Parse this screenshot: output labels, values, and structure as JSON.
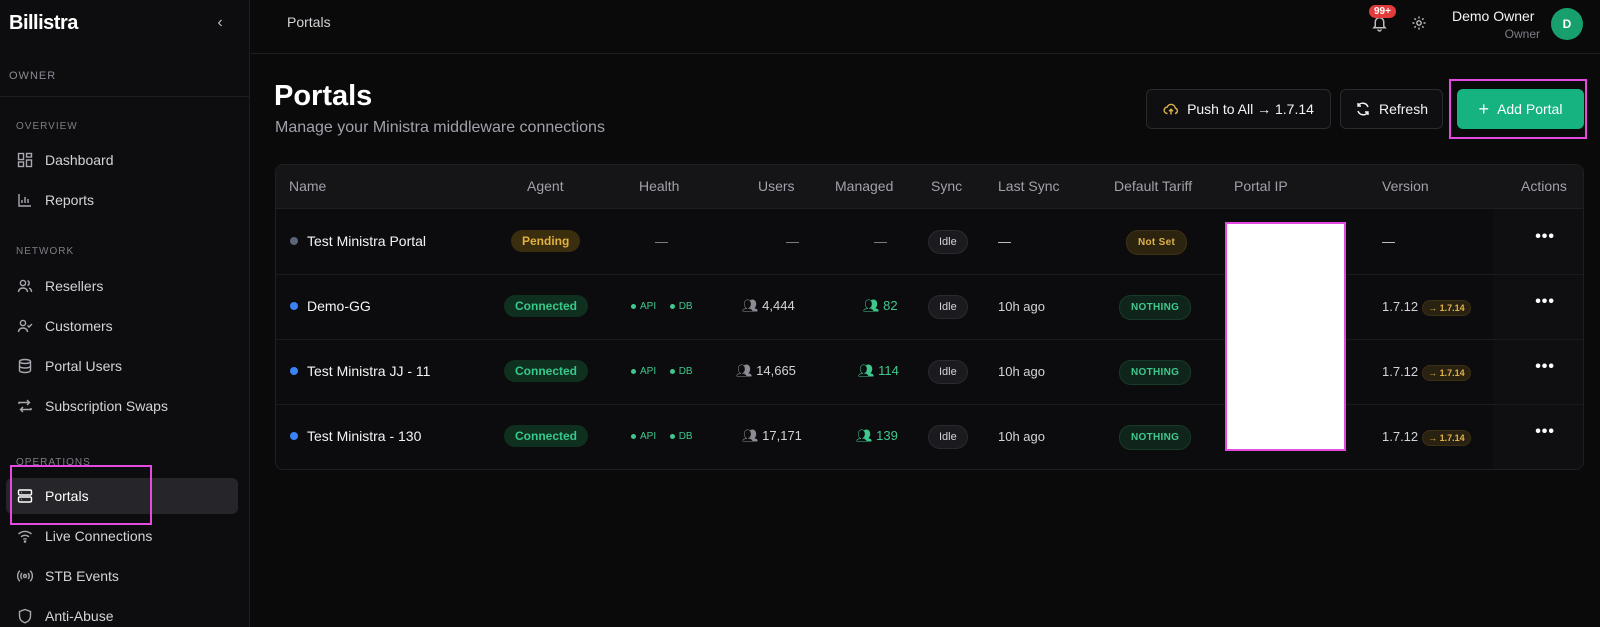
{
  "app": {
    "brand": "Billistra"
  },
  "sidebar": {
    "owner_label": "OWNER",
    "sections": {
      "overview": "OVERVIEW",
      "network": "NETWORK",
      "operations": "OPERATIONS"
    },
    "items": [
      {
        "label": "Dashboard",
        "icon": "dashboard-icon"
      },
      {
        "label": "Reports",
        "icon": "bar-chart-icon"
      },
      {
        "label": "Resellers",
        "icon": "users-icon"
      },
      {
        "label": "Customers",
        "icon": "user-check-icon"
      },
      {
        "label": "Portal Users",
        "icon": "database-icon"
      },
      {
        "label": "Subscription Swaps",
        "icon": "swap-icon"
      },
      {
        "label": "Portals",
        "icon": "server-icon",
        "active": true
      },
      {
        "label": "Live Connections",
        "icon": "wifi-icon"
      },
      {
        "label": "STB Events",
        "icon": "broadcast-icon"
      },
      {
        "label": "Anti-Abuse",
        "icon": "shield-icon"
      }
    ]
  },
  "topbar": {
    "breadcrumb": "Portals",
    "notifications_count": "99+",
    "user_name": "Demo Owner",
    "user_role": "Owner",
    "avatar_initial": "D"
  },
  "header": {
    "title": "Portals",
    "subtitle": "Manage your Ministra middleware connections",
    "push_label": "Push to All → 1.7.14",
    "refresh_label": "Refresh",
    "add_label": "Add Portal"
  },
  "table": {
    "columns": [
      "Name",
      "Agent",
      "Health",
      "Users",
      "Managed",
      "Sync",
      "Last Sync",
      "Default Tariff",
      "Portal IP",
      "Version",
      "Actions"
    ],
    "rows": [
      {
        "name": "Test Ministra Portal",
        "dot_color": "#5b6478",
        "agent": "Pending",
        "agent_status": "pending",
        "health_api": "—",
        "users": "—",
        "managed": "—",
        "sync": "Idle",
        "last_sync": "—",
        "tariff": "Not Set",
        "tariff_status": "notset",
        "version": "—",
        "version_badge": ""
      },
      {
        "name": "Demo-GG",
        "dot_color": "#3b82f6",
        "agent": "Connected",
        "agent_status": "connected",
        "health_api": "API",
        "health_db": "DB",
        "users": "4,444",
        "managed": "82",
        "sync": "Idle",
        "last_sync": "10h ago",
        "tariff": "NOTHING",
        "tariff_status": "nothing",
        "version": "1.7.12",
        "version_badge": "→ 1.7.14"
      },
      {
        "name": "Test Ministra JJ - 11",
        "dot_color": "#3b82f6",
        "agent": "Connected",
        "agent_status": "connected",
        "health_api": "API",
        "health_db": "DB",
        "users": "14,665",
        "managed": "114",
        "sync": "Idle",
        "last_sync": "10h ago",
        "tariff": "NOTHING",
        "tariff_status": "nothing",
        "version": "1.7.12",
        "version_badge": "→ 1.7.14"
      },
      {
        "name": "Test Ministra - 130",
        "dot_color": "#3b82f6",
        "agent": "Connected",
        "agent_status": "connected",
        "health_api": "API",
        "health_db": "DB",
        "users": "17,171",
        "managed": "139",
        "sync": "Idle",
        "last_sync": "10h ago",
        "tariff": "NOTHING",
        "tariff_status": "nothing",
        "version": "1.7.12",
        "version_badge": "→ 1.7.14"
      }
    ],
    "actions_symbol": "•••"
  },
  "colors": {
    "accent": "#16b380",
    "highlight": "#e54ae0",
    "background": "#0a0a0b"
  }
}
